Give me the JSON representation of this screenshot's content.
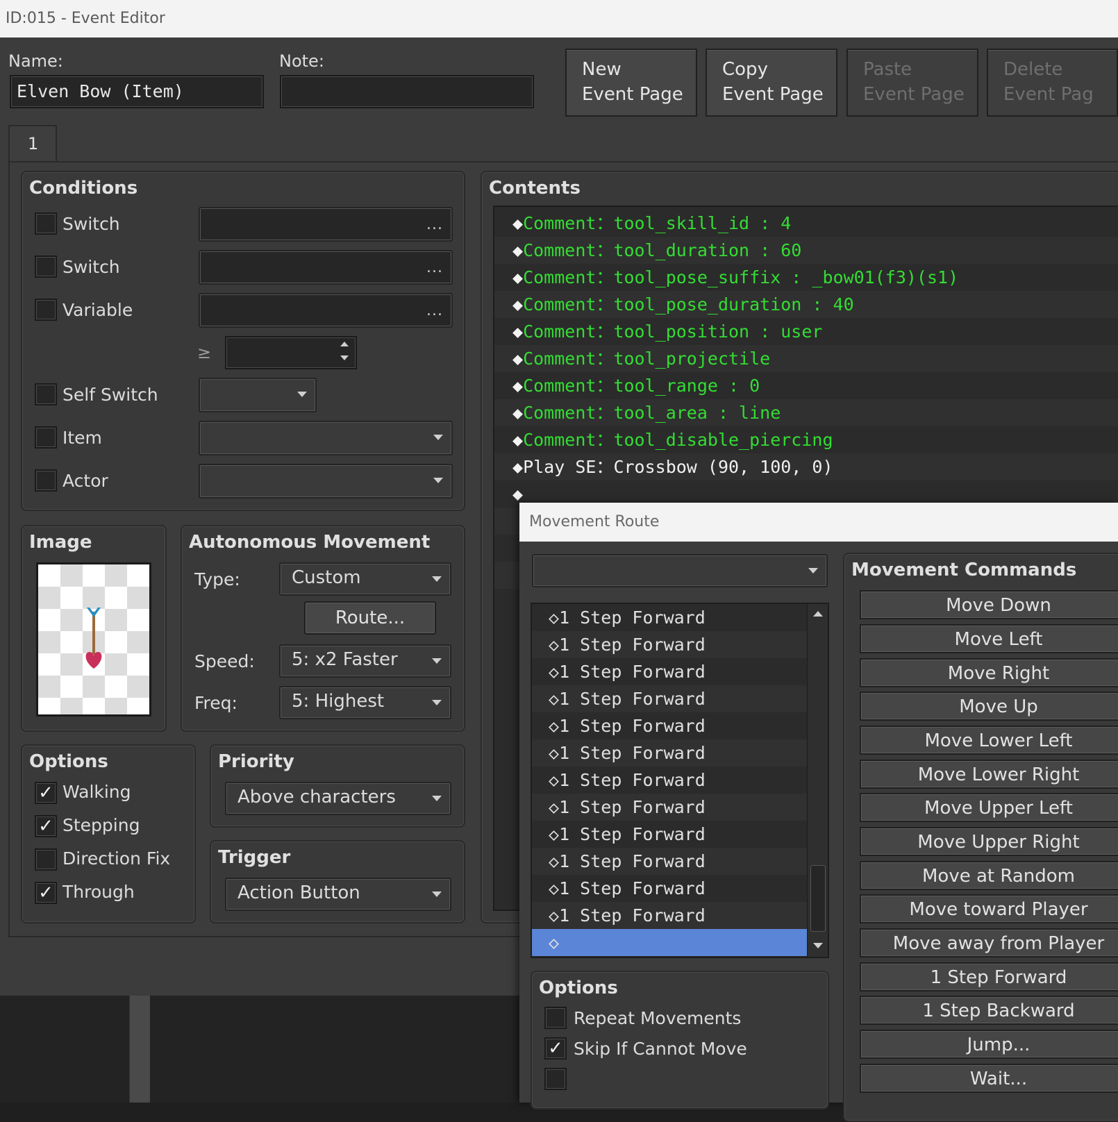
{
  "window": {
    "title": "ID:015 - Event Editor"
  },
  "event": {
    "name_label": "Name:",
    "name_value": "Elven Bow (Item)",
    "note_label": "Note:",
    "note_value": ""
  },
  "toolbar": {
    "new": [
      "New",
      "Event Page"
    ],
    "copy": [
      "Copy",
      "Event Page"
    ],
    "paste": [
      "Paste",
      "Event Page"
    ],
    "delete": [
      "Delete",
      "Event Pag"
    ]
  },
  "page_tab": "1",
  "conditions": {
    "title": "Conditions",
    "items": [
      {
        "label": "Switch",
        "checked": false
      },
      {
        "label": "Switch",
        "checked": false
      },
      {
        "label": "Variable",
        "checked": false
      },
      {
        "label": "Self Switch",
        "checked": false
      },
      {
        "label": "Item",
        "checked": false
      },
      {
        "label": "Actor",
        "checked": false
      }
    ],
    "dots": "...",
    "gte": "≥"
  },
  "image": {
    "title": "Image"
  },
  "autonomous": {
    "title": "Autonomous Movement",
    "type_label": "Type:",
    "type_value": "Custom",
    "route_button": "Route...",
    "speed_label": "Speed:",
    "speed_value": "5: x2 Faster",
    "freq_label": "Freq:",
    "freq_value": "5: Highest"
  },
  "options": {
    "title": "Options",
    "items": [
      {
        "label": "Walking",
        "checked": true
      },
      {
        "label": "Stepping",
        "checked": true
      },
      {
        "label": "Direction Fix",
        "checked": false
      },
      {
        "label": "Through",
        "checked": true
      }
    ]
  },
  "priority": {
    "title": "Priority",
    "value": "Above characters"
  },
  "trigger": {
    "title": "Trigger",
    "value": "Action Button"
  },
  "contents": {
    "title": "Contents",
    "rows": [
      {
        "cmd": "Comment",
        "sep": "：",
        "text": "tool_skill_id : 4"
      },
      {
        "cmd": "Comment",
        "sep": "：",
        "text": "tool_duration : 60"
      },
      {
        "cmd": "Comment",
        "sep": "：",
        "text": "tool_pose_suffix : _bow01(f3)(s1)"
      },
      {
        "cmd": "Comment",
        "sep": "：",
        "text": "tool_pose_duration : 40"
      },
      {
        "cmd": "Comment",
        "sep": "：",
        "text": "tool_position : user"
      },
      {
        "cmd": "Comment",
        "sep": "：",
        "text": "tool_projectile"
      },
      {
        "cmd": "Comment",
        "sep": "：",
        "text": "tool_range : 0"
      },
      {
        "cmd": "Comment",
        "sep": "：",
        "text": "tool_area : line"
      },
      {
        "cmd": "Comment",
        "sep": "：",
        "text": "tool_disable_piercing"
      },
      {
        "cmd": "Play SE",
        "sep": "：",
        "text": "Crossbow (90, 100, 0)"
      },
      {
        "cmd": "",
        "sep": "",
        "text": ""
      }
    ],
    "diamond": "◆"
  },
  "movement_route": {
    "title": "Movement Route",
    "target_value": "",
    "rows": [
      "1 Step Forward",
      "1 Step Forward",
      "1 Step Forward",
      "1 Step Forward",
      "1 Step Forward",
      "1 Step Forward",
      "1 Step Forward",
      "1 Step Forward",
      "1 Step Forward",
      "1 Step Forward",
      "1 Step Forward",
      "1 Step Forward",
      ""
    ],
    "diamond": "◇",
    "options_title": "Options",
    "options": [
      {
        "label": "Repeat Movements",
        "checked": false
      },
      {
        "label": "Skip If Cannot Move",
        "checked": true
      }
    ],
    "commands_title": "Movement Commands",
    "commands": [
      "Move Down",
      "Move Left",
      "Move Right",
      "Move Up",
      "Move Lower Left",
      "Move Lower Right",
      "Move Upper Left",
      "Move Upper Right",
      "Move at Random",
      "Move toward Player",
      "Move away from Player",
      "1 Step Forward",
      "1 Step Backward",
      "Jump...",
      "Wait..."
    ]
  },
  "colors": {
    "comment": "#33dd33",
    "selection": "#5b85d6",
    "background": "#3c3c3c"
  }
}
